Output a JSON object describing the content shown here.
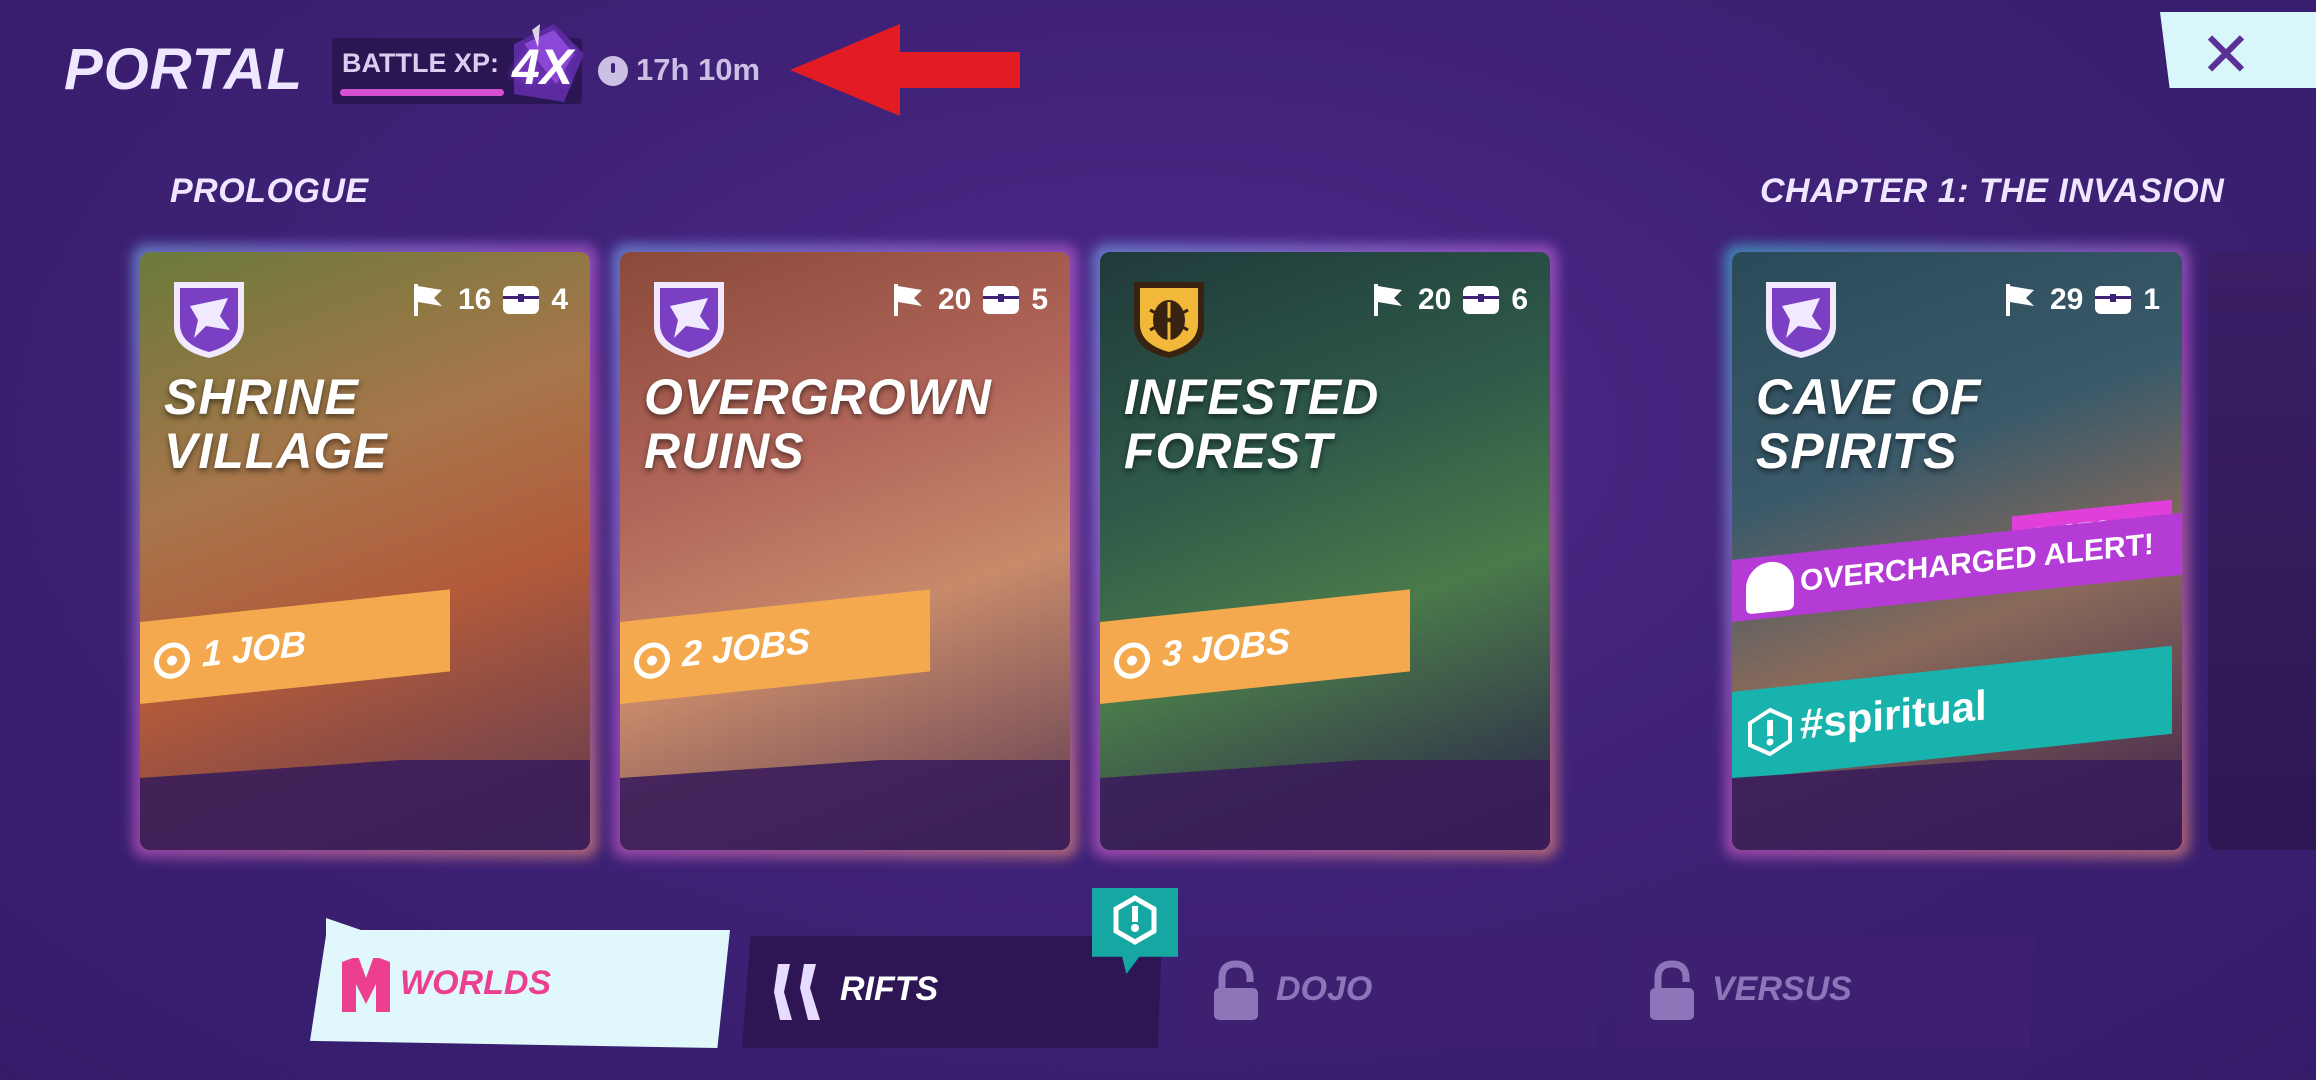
{
  "header": {
    "title": "PORTAL",
    "battle_xp_label": "BATTLE XP:",
    "battle_xp_multiplier": "4X",
    "battle_xp_progress": 0.7,
    "timer": "17h 10m",
    "close_label": "✕"
  },
  "sections": {
    "prologue": "PROLOGUE",
    "chapter1": "CHAPTER 1: THE INVASION"
  },
  "cards": [
    {
      "title_line1": "SHRINE",
      "title_line2": "VILLAGE",
      "flags": "16",
      "chests": "4",
      "jobs": "1 JOB",
      "emblem": "dragon-emblem-icon",
      "emblem_color": "#7b3fc4"
    },
    {
      "title_line1": "OVERGROWN",
      "title_line2": "RUINS",
      "flags": "20",
      "chests": "5",
      "jobs": "2 JOBS",
      "emblem": "dragon-emblem-icon",
      "emblem_color": "#7b3fc4"
    },
    {
      "title_line1": "INFESTED",
      "title_line2": "FOREST",
      "flags": "20",
      "chests": "6",
      "jobs": "3 JOBS",
      "emblem": "beetle-emblem-icon",
      "emblem_color": "#f2b83a"
    },
    {
      "title_line1": "CAVE OF",
      "title_line2": "SPIRITS",
      "flags": "29",
      "chests": "1",
      "alert_timer": "27S",
      "alert": "OVERCHARGED ALERT!",
      "tag": "#spiritual",
      "emblem": "dragon-emblem-icon",
      "emblem_color": "#7b3fc4"
    }
  ],
  "tabs": {
    "worlds": "WORLDS",
    "rifts": "RIFTS",
    "dojo": "DOJO",
    "versus": "VERSUS"
  },
  "colors": {
    "background": "#3f2278",
    "job_banner": "#f4a94e",
    "alert_pink": "#e040d9",
    "tag_teal": "#18b3ad",
    "active_tab": "#e0f8fc",
    "worlds_accent": "#ec3f8f"
  }
}
